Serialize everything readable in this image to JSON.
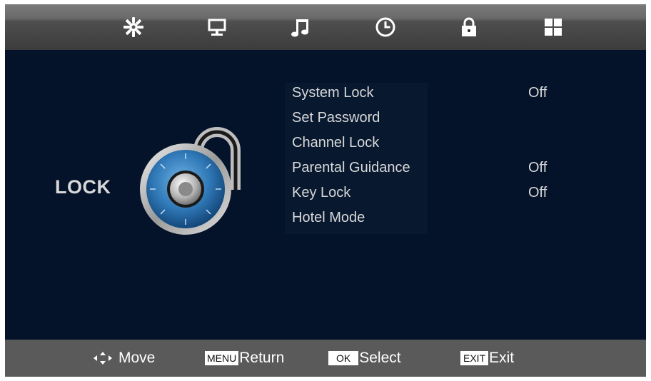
{
  "top_tabs": [
    {
      "id": "picture",
      "icon": "picture-icon"
    },
    {
      "id": "screen",
      "icon": "monitor-icon"
    },
    {
      "id": "sound",
      "icon": "music-note-icon"
    },
    {
      "id": "time",
      "icon": "clock-icon"
    },
    {
      "id": "lock",
      "icon": "padlock-icon",
      "active": true
    },
    {
      "id": "setup",
      "icon": "grid-icon"
    }
  ],
  "page": {
    "title": "LOCK"
  },
  "menu": {
    "items": [
      {
        "label": "System Lock",
        "value": "Off"
      },
      {
        "label": "Set Password",
        "value": ""
      },
      {
        "label": "Channel Lock",
        "value": ""
      },
      {
        "label": "Parental Guidance",
        "value": "Off"
      },
      {
        "label": "Key Lock",
        "value": "Off"
      },
      {
        "label": "Hotel Mode",
        "value": ""
      }
    ]
  },
  "hints": {
    "move_label": "Move",
    "menu_key": "MENU",
    "return_label": "Return",
    "ok_key": "OK",
    "select_label": "Select",
    "exit_key": "EXIT",
    "exit_label": "Exit"
  },
  "colors": {
    "background": "#04122a",
    "bar": "#5a5a5a",
    "text": "#d8d8d8",
    "dial": "#2f78b6"
  }
}
